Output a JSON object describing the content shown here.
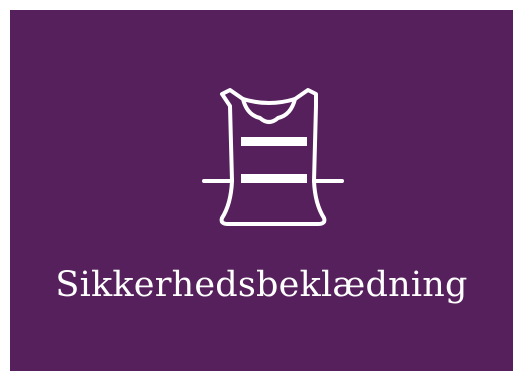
{
  "tile": {
    "label": "Sikkerhedsbeklædning",
    "icon": "safety-vest-icon",
    "background_color": "#56205c",
    "foreground_color": "#ffffff"
  }
}
